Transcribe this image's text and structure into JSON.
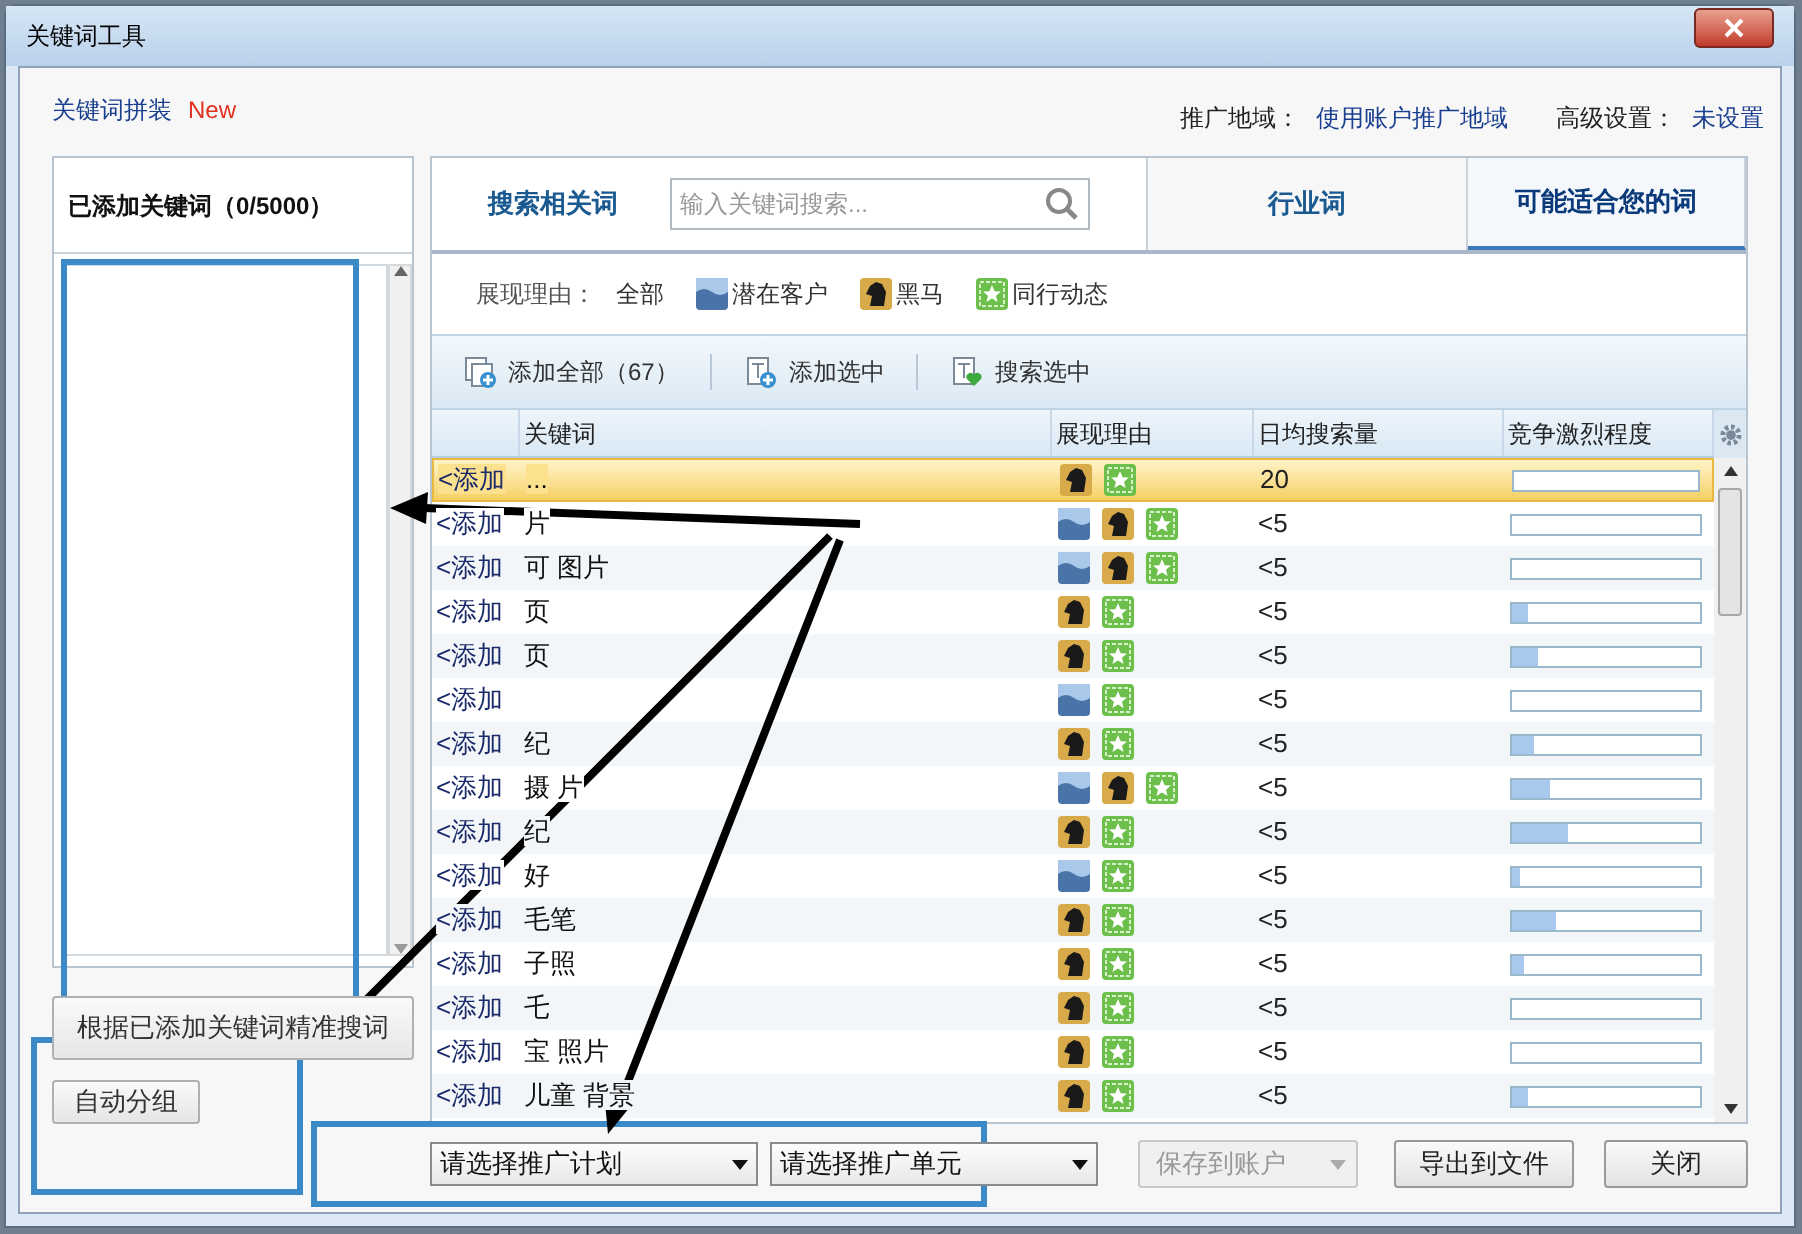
{
  "window": {
    "title": "关键词工具"
  },
  "header": {
    "link": "关键词拼装",
    "badge": "New",
    "region_label": "推广地域：",
    "region_value": "使用账户推广地域",
    "advanced_label": "高级设置：",
    "advanced_value": "未设置"
  },
  "left_panel": {
    "title": "已添加关键词（0/5000）",
    "buttons": [
      "根据已添加关键词精准搜词",
      "自动分组"
    ]
  },
  "tabs": [
    {
      "label": "搜索相关词",
      "selected": false
    },
    {
      "label": "行业词",
      "selected": false
    },
    {
      "label": "可能适合您的词",
      "selected": true
    }
  ],
  "search": {
    "placeholder": "输入关键词搜索..."
  },
  "filter": {
    "label": "展现理由：",
    "options": [
      {
        "kind": "all",
        "label": "全部"
      },
      {
        "kind": "potential",
        "label": "潜在客户"
      },
      {
        "kind": "darkhorse",
        "label": "黑马"
      },
      {
        "kind": "peer",
        "label": "同行动态"
      }
    ]
  },
  "toolbar": [
    {
      "kind": "add_all",
      "label": "添加全部（67）"
    },
    {
      "kind": "add_selected",
      "label": "添加选中"
    },
    {
      "kind": "search_selected",
      "label": "搜索选中"
    }
  ],
  "table": {
    "columns": [
      "关键词",
      "展现理由",
      "日均搜索量",
      "竞争激烈程度"
    ],
    "rows": [
      {
        "action": "<添加",
        "keyword": "...",
        "reasons": [
          {
            "kind": "darkhorse"
          },
          {
            "kind": "peer"
          }
        ],
        "volume": "20",
        "level": 0,
        "selected": true
      },
      {
        "action": "<添加",
        "keyword": "片",
        "reasons": [
          {
            "kind": "potential"
          },
          {
            "kind": "darkhorse"
          },
          {
            "kind": "peer"
          }
        ],
        "volume": "<5",
        "level": 0,
        "selected": false
      },
      {
        "action": "<添加",
        "keyword": "可 图片",
        "reasons": [
          {
            "kind": "potential"
          },
          {
            "kind": "darkhorse"
          },
          {
            "kind": "peer"
          }
        ],
        "volume": "<5",
        "level": 0,
        "selected": false
      },
      {
        "action": "<添加",
        "keyword": "页",
        "reasons": [
          {
            "kind": "darkhorse"
          },
          {
            "kind": "peer"
          }
        ],
        "volume": "<5",
        "level": 0.08,
        "selected": false
      },
      {
        "action": "<添加",
        "keyword": "页",
        "reasons": [
          {
            "kind": "darkhorse"
          },
          {
            "kind": "peer"
          }
        ],
        "volume": "<5",
        "level": 0.14,
        "selected": false
      },
      {
        "action": "<添加",
        "reasons": [
          {
            "kind": "potential"
          },
          {
            "kind": "peer"
          }
        ],
        "volume": "<5",
        "level": 0,
        "selected": false
      },
      {
        "action": "<添加",
        "keyword": "纪",
        "reasons": [
          {
            "kind": "darkhorse"
          },
          {
            "kind": "peer"
          }
        ],
        "volume": "<5",
        "level": 0.12,
        "selected": false
      },
      {
        "action": "<添加",
        "keyword": "摄 片",
        "reasons": [
          {
            "kind": "potential"
          },
          {
            "kind": "darkhorse"
          },
          {
            "kind": "peer"
          }
        ],
        "volume": "<5",
        "level": 0.2,
        "selected": false
      },
      {
        "action": "<添加",
        "keyword": "纪",
        "reasons": [
          {
            "kind": "darkhorse"
          },
          {
            "kind": "peer"
          }
        ],
        "volume": "<5",
        "level": 0.3,
        "selected": false
      },
      {
        "action": "<添加",
        "keyword": "好",
        "reasons": [
          {
            "kind": "potential"
          },
          {
            "kind": "peer"
          }
        ],
        "volume": "<5",
        "level": 0.04,
        "selected": false
      },
      {
        "action": "<添加",
        "keyword": "毛笔",
        "reasons": [
          {
            "kind": "darkhorse"
          },
          {
            "kind": "peer"
          }
        ],
        "volume": "<5",
        "level": 0.23,
        "selected": false
      },
      {
        "action": "<添加",
        "keyword": "子照",
        "reasons": [
          {
            "kind": "darkhorse"
          },
          {
            "kind": "peer"
          }
        ],
        "volume": "<5",
        "level": 0.06,
        "selected": false
      },
      {
        "action": "<添加",
        "keyword": "乇",
        "reasons": [
          {
            "kind": "darkhorse"
          },
          {
            "kind": "peer"
          }
        ],
        "volume": "<5",
        "level": 0,
        "selected": false
      },
      {
        "action": "<添加",
        "keyword": "宝 照片",
        "reasons": [
          {
            "kind": "darkhorse"
          },
          {
            "kind": "peer"
          }
        ],
        "volume": "<5",
        "level": 0,
        "selected": false
      },
      {
        "action": "<添加",
        "keyword": "儿童 背景",
        "reasons": [
          {
            "kind": "darkhorse"
          },
          {
            "kind": "peer"
          }
        ],
        "volume": "<5",
        "level": 0.08,
        "selected": false
      }
    ]
  },
  "footer": {
    "plan_select": "请选择推广计划",
    "unit_select": "请选择推广单元",
    "buttons": [
      {
        "kind": "save",
        "label": "保存到账户",
        "disabled": true
      },
      {
        "kind": "export",
        "label": "导出到文件",
        "disabled": false
      },
      {
        "kind": "close",
        "label": "关闭",
        "disabled": false
      }
    ]
  }
}
